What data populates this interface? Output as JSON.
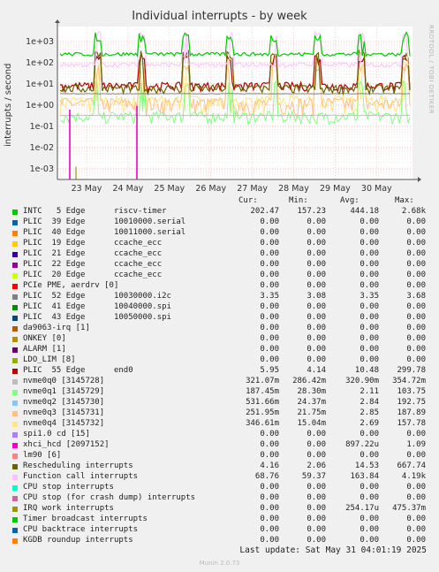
{
  "title": "Individual interrupts - by week",
  "side_text": "RRDTOOL / TOBI OETIKER",
  "footer": "Munin 2.0.73",
  "last_update": "Last update: Sat May 31 04:01:19 2025",
  "legend_headers": {
    "cur": "Cur:",
    "min": "Min:",
    "avg": "Avg:",
    "max": "Max:"
  },
  "chart_data": {
    "type": "line",
    "title": "Individual interrupts - by week",
    "ylabel": "interrupts / second",
    "yscale": "log",
    "ylim": [
      0.0003,
      5000
    ],
    "y_ticks": [
      "1e-03",
      "1e-02",
      "1e-01",
      "1e+00",
      "1e+01",
      "1e+02",
      "1e+03"
    ],
    "x_ticks": [
      "23 May",
      "24 May",
      "25 May",
      "26 May",
      "27 May",
      "28 May",
      "29 May",
      "30 May"
    ],
    "grid": true,
    "series": [
      {
        "name": "INTC   5 Edge      riscv-timer",
        "color": "#00cc00",
        "cur": "202.47",
        "min": "157.23",
        "avg": "444.18",
        "max": "2.68k"
      },
      {
        "name": "PLIC  39 Edge      10010000.serial",
        "color": "#0066b3",
        "cur": "0.00",
        "min": "0.00",
        "avg": "0.00",
        "max": "0.00"
      },
      {
        "name": "PLIC  40 Edge      10011000.serial",
        "color": "#ff8000",
        "cur": "0.00",
        "min": "0.00",
        "avg": "0.00",
        "max": "0.00"
      },
      {
        "name": "PLIC  19 Edge      ccache_ecc",
        "color": "#ffcc00",
        "cur": "0.00",
        "min": "0.00",
        "avg": "0.00",
        "max": "0.00"
      },
      {
        "name": "PLIC  21 Edge      ccache_ecc",
        "color": "#330099",
        "cur": "0.00",
        "min": "0.00",
        "avg": "0.00",
        "max": "0.00"
      },
      {
        "name": "PLIC  22 Edge      ccache_ecc",
        "color": "#990099",
        "cur": "0.00",
        "min": "0.00",
        "avg": "0.00",
        "max": "0.00"
      },
      {
        "name": "PLIC  20 Edge      ccache_ecc",
        "color": "#ccff00",
        "cur": "0.00",
        "min": "0.00",
        "avg": "0.00",
        "max": "0.00"
      },
      {
        "name": "PCIe PME, aerdrv [0]",
        "color": "#ff0000",
        "cur": "0.00",
        "min": "0.00",
        "avg": "0.00",
        "max": "0.00"
      },
      {
        "name": "PLIC  52 Edge      10030000.i2c",
        "color": "#808080",
        "cur": "3.35",
        "min": "3.08",
        "avg": "3.35",
        "max": "3.68"
      },
      {
        "name": "PLIC  41 Edge      10040000.spi",
        "color": "#008f00",
        "cur": "0.00",
        "min": "0.00",
        "avg": "0.00",
        "max": "0.00"
      },
      {
        "name": "PLIC  43 Edge      10050000.spi",
        "color": "#00487d",
        "cur": "0.00",
        "min": "0.00",
        "avg": "0.00",
        "max": "0.00"
      },
      {
        "name": "da9063-irq [1]",
        "color": "#b35a00",
        "cur": "0.00",
        "min": "0.00",
        "avg": "0.00",
        "max": "0.00"
      },
      {
        "name": "ONKEY [0]",
        "color": "#b38f00",
        "cur": "0.00",
        "min": "0.00",
        "avg": "0.00",
        "max": "0.00"
      },
      {
        "name": "ALARM [1]",
        "color": "#6b006b",
        "cur": "0.00",
        "min": "0.00",
        "avg": "0.00",
        "max": "0.00"
      },
      {
        "name": "LDO_LIM [8]",
        "color": "#8fb300",
        "cur": "0.00",
        "min": "0.00",
        "avg": "0.00",
        "max": "0.00"
      },
      {
        "name": "PLIC  55 Edge      end0",
        "color": "#b30000",
        "cur": "5.95",
        "min": "4.14",
        "avg": "10.48",
        "max": "299.78"
      },
      {
        "name": "nvme0q0 [3145728]",
        "color": "#bebebe",
        "cur": "321.07m",
        "min": "286.42m",
        "avg": "320.90m",
        "max": "354.72m"
      },
      {
        "name": "nvme0q1 [3145729]",
        "color": "#80ff80",
        "cur": "187.45m",
        "min": "28.30m",
        "avg": "2.11",
        "max": "103.75"
      },
      {
        "name": "nvme0q2 [3145730]",
        "color": "#80c9ff",
        "cur": "531.66m",
        "min": "24.37m",
        "avg": "2.84",
        "max": "192.75"
      },
      {
        "name": "nvme0q3 [3145731]",
        "color": "#ffc080",
        "cur": "251.95m",
        "min": "21.75m",
        "avg": "2.85",
        "max": "187.89"
      },
      {
        "name": "nvme0q4 [3145732]",
        "color": "#ffe680",
        "cur": "346.61m",
        "min": "15.04m",
        "avg": "2.69",
        "max": "157.78"
      },
      {
        "name": "spi1.0 cd [15]",
        "color": "#aa80ff",
        "cur": "0.00",
        "min": "0.00",
        "avg": "0.00",
        "max": "0.00"
      },
      {
        "name": "xhci_hcd [2097152]",
        "color": "#ee00cc",
        "cur": "0.00",
        "min": "0.00",
        "avg": "897.22u",
        "max": "1.09"
      },
      {
        "name": "lm90 [6]",
        "color": "#ff8080",
        "cur": "0.00",
        "min": "0.00",
        "avg": "0.00",
        "max": "0.00"
      },
      {
        "name": "Rescheduling interrupts",
        "color": "#666600",
        "cur": "4.16",
        "min": "2.06",
        "avg": "14.53",
        "max": "667.74"
      },
      {
        "name": "Function call interrupts",
        "color": "#ffbfff",
        "cur": "68.76",
        "min": "59.37",
        "avg": "163.84",
        "max": "4.19k"
      },
      {
        "name": "CPU stop interrupts",
        "color": "#00ffcc",
        "cur": "0.00",
        "min": "0.00",
        "avg": "0.00",
        "max": "0.00"
      },
      {
        "name": "CPU stop (for crash dump) interrupts",
        "color": "#cc6699",
        "cur": "0.00",
        "min": "0.00",
        "avg": "0.00",
        "max": "0.00"
      },
      {
        "name": "IRQ work interrupts",
        "color": "#999900",
        "cur": "0.00",
        "min": "0.00",
        "avg": "254.17u",
        "max": "475.37m"
      },
      {
        "name": "Timer broadcast interrupts",
        "color": "#00cc00",
        "cur": "0.00",
        "min": "0.00",
        "avg": "0.00",
        "max": "0.00"
      },
      {
        "name": "CPU backtrace interrupts",
        "color": "#0066b3",
        "cur": "0.00",
        "min": "0.00",
        "avg": "0.00",
        "max": "0.00"
      },
      {
        "name": "KGDB roundup interrupts",
        "color": "#ff8000",
        "cur": "0.00",
        "min": "0.00",
        "avg": "0.00",
        "max": "0.00"
      }
    ]
  }
}
